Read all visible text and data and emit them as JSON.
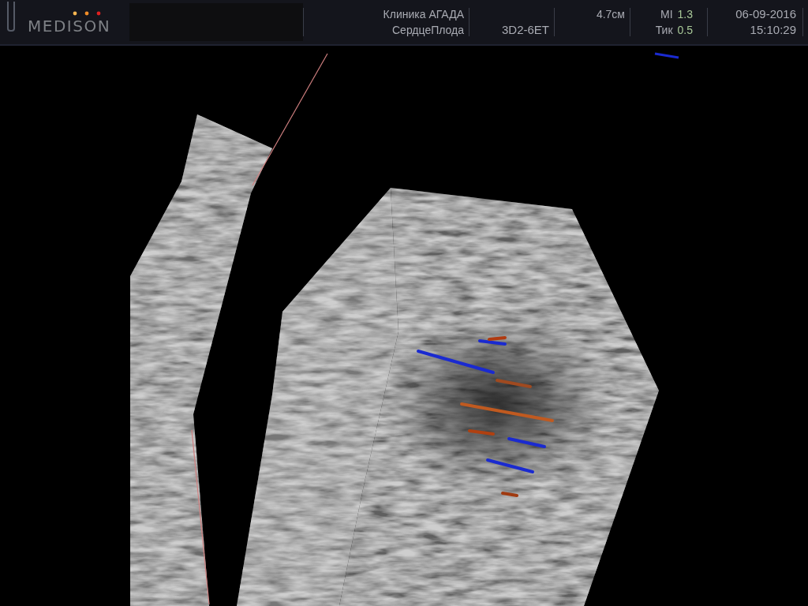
{
  "header": {
    "logo": "MEDISON",
    "clinic": "Клиника АГАДА",
    "preset": "СердцеПлода",
    "probe": "3D2-6ET",
    "depth": "4.7см",
    "mi": {
      "label": "MI",
      "value": "1.3"
    },
    "tic": {
      "label": "Тик",
      "value": "0.5"
    },
    "date": "06-09-2016",
    "time": "15:10:29"
  }
}
